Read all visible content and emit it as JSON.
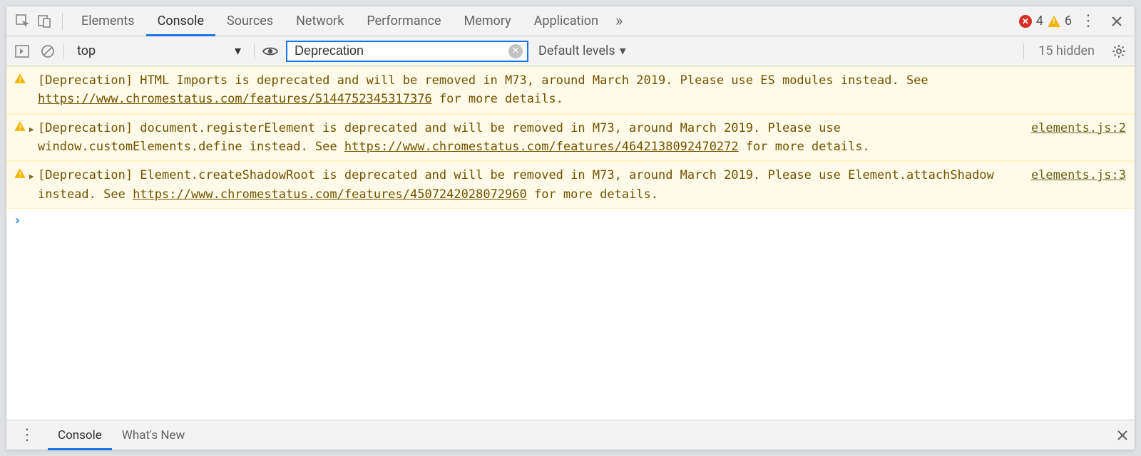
{
  "tabs": {
    "items": [
      "Elements",
      "Console",
      "Sources",
      "Network",
      "Performance",
      "Memory",
      "Application"
    ],
    "active_index": 1,
    "error_count": "4",
    "warn_count": "6"
  },
  "filter": {
    "context": "top",
    "search_value": "Deprecation",
    "levels_label": "Default levels",
    "hidden_label": "15 hidden"
  },
  "entries": [
    {
      "expandable": false,
      "text_before": "[Deprecation] HTML Imports is deprecated and will be removed in M73, around March 2019. Please use ES modules instead. See ",
      "link": "https://www.chromestatus.com/features/5144752345317376",
      "text_after": " for more details.",
      "source": ""
    },
    {
      "expandable": true,
      "text_before": "[Deprecation] document.registerElement is deprecated and will be removed in M73, around March 2019. Please use window.customElements.define instead. See ",
      "link": "https://www.chromestatus.com/features/4642138092470272",
      "text_after": " for more details.",
      "source": "elements.js:2"
    },
    {
      "expandable": true,
      "text_before": "[Deprecation] Element.createShadowRoot is deprecated and will be removed in M73, around March 2019. Please use Element.attachShadow instead. See ",
      "link": "https://www.chromestatus.com/features/4507242028072960",
      "text_after": " for more details.",
      "source": "elements.js:3"
    }
  ],
  "drawer": {
    "items": [
      "Console",
      "What's New"
    ],
    "active_index": 0
  }
}
